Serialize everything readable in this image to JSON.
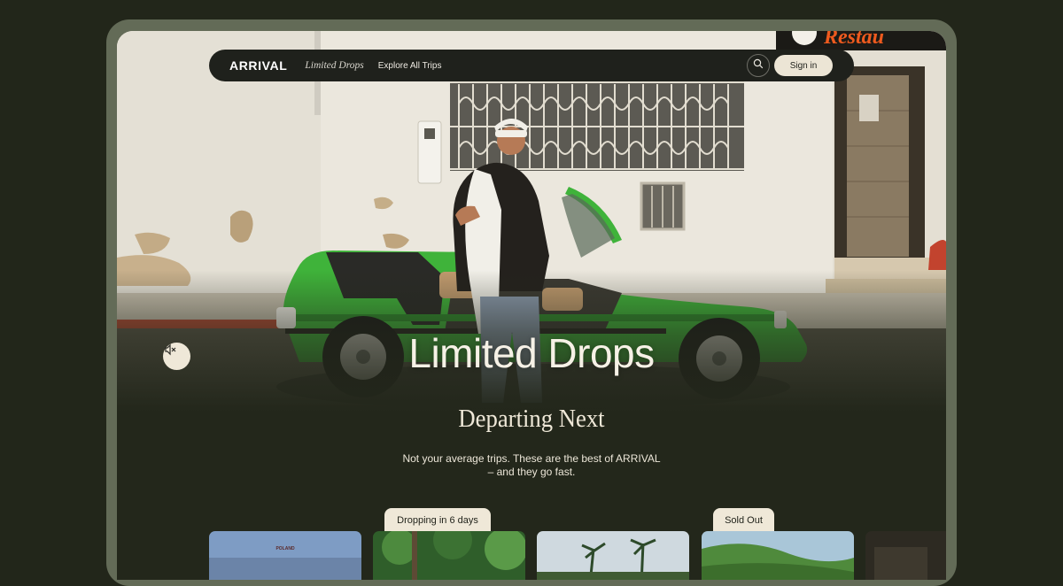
{
  "nav": {
    "logo": "ARRIVAL",
    "limited_drops_link": "Limited Drops",
    "explore_link": "Explore All Trips",
    "sign_in": "Sign in"
  },
  "hero": {
    "title": "Limited Drops",
    "storefront_sign": "Restau"
  },
  "section": {
    "title": "Departing Next",
    "description": "Not your average trips. These are the best of ARRIVAL – and they go fast."
  },
  "cards": [
    {
      "label": "POLAND"
    },
    {
      "badge": "Dropping in 6 days"
    },
    {},
    {
      "badge": "Sold Out"
    },
    {}
  ],
  "colors": {
    "background": "#22261a",
    "frame": "#636b57",
    "cream": "#efe8d8",
    "car_green": "#3fb33a",
    "sign_orange": "#ee5a1e"
  },
  "icons": [
    "mute-icon",
    "search-icon"
  ]
}
